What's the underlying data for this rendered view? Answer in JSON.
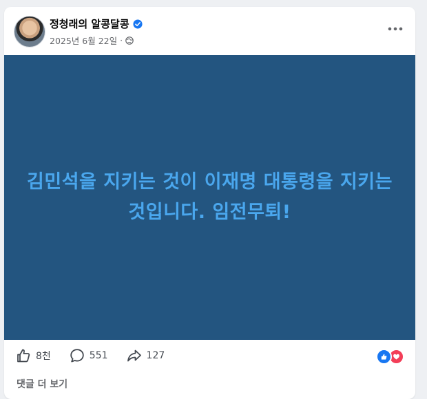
{
  "post": {
    "author_name": "정청래의 알콩달콩",
    "date": "2025년 6월 22일",
    "separator": "·",
    "verified_icon": "verified-badge-icon",
    "privacy_icon": "globe-icon",
    "more_icon": "more-options-icon",
    "image_text": "김민석을 지키는 것이 이재명 대통령을 지키는 것입니다. 임전무퇴!",
    "image_bg_color": "#235580",
    "image_text_color": "#4aa7ee"
  },
  "actions": {
    "like_count": "8천",
    "comment_count": "551",
    "share_count": "127"
  },
  "reactions": [
    "like",
    "love"
  ],
  "comments_link": "댓글 더 보기"
}
